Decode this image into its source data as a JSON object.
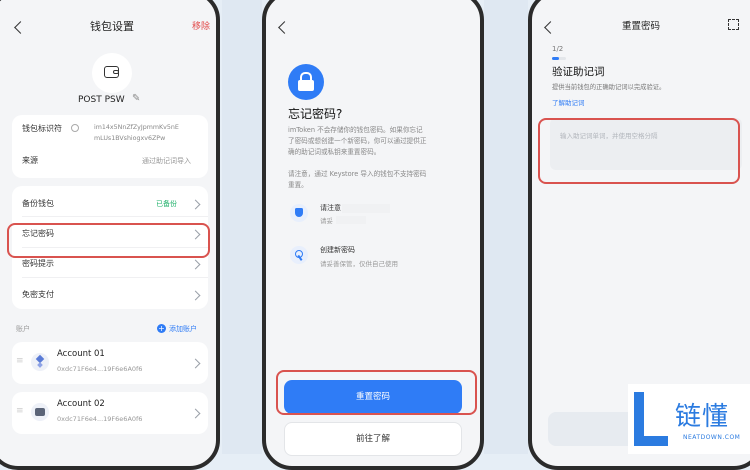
{
  "colors": {
    "accent": "#2f7cf6",
    "danger": "#e24a4a",
    "green": "#1fb06a",
    "highlight": "#d9534f"
  },
  "s1": {
    "title": "钱包设置",
    "remove": "移除",
    "wallet_name": "POST PSW",
    "id_label": "钱包标识符",
    "id_value_1": "im14x5NnZfZyJpmmKv5nE",
    "id_value_2": "mLUs1BVshiogxv6ZPw",
    "source_label": "来源",
    "source_value": "通过助记词导入",
    "backup_label": "备份钱包",
    "backup_status": "已备份",
    "forgot_label": "忘记密码",
    "hint_label": "密码提示",
    "nopass_label": "免密支付",
    "accounts_header": "账户",
    "add_account": "添加账户",
    "accounts": [
      {
        "name": "Account 01",
        "address": "0xdc71F6e4...19F6e6A0f6"
      },
      {
        "name": "Account 02",
        "address": "0xdc71F6e4...19F6e6A0f6"
      }
    ]
  },
  "s2": {
    "title": "忘记密码?",
    "desc": [
      "imToken 不会存储你的钱包密码。如果你忘记",
      "了密码或想创建一个新密码，你可以通过提供正",
      "确的助记词或私钥来重置密码。"
    ],
    "note": [
      "请注意，通过 Keystore 导入的钱包不支持密码",
      "重置。"
    ],
    "item1_title": "请注意",
    "item1_sub": "请妥",
    "item2_title": "创建新密码",
    "item2_sub": "请妥善保管，仅供自己使用",
    "reset_button": "重置密码",
    "learn_button": "前往了解"
  },
  "s3": {
    "title": "重置密码",
    "step": "1/2",
    "heading": "验证助记词",
    "desc": "提供当前钱包的正确助记词以完成验证。",
    "link": "了解助记词",
    "placeholder": "输入助记词单词，并使用空格分隔"
  },
  "logo": {
    "chars": "链懂",
    "sub": "NEATDOWN.COM"
  }
}
